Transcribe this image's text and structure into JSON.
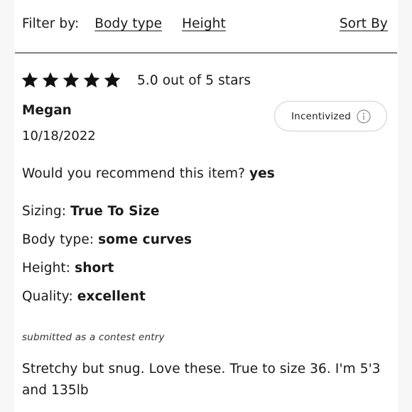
{
  "filter_bar": {
    "label": "Filter by:",
    "body_type_link": "Body type",
    "height_link": "Height",
    "sort_by_link": "Sort By"
  },
  "review": {
    "rating": 5,
    "rating_text": "5.0 out of 5 stars",
    "star_icons": [
      "star-filled",
      "star-filled",
      "star-filled",
      "star-filled",
      "star-filled"
    ],
    "reviewer_name": "Megan",
    "date": "10/18/2022",
    "badge": {
      "label": "Incentivized",
      "icon": "info-circle-icon"
    },
    "recommend_label": "Would you recommend this item?",
    "recommend_value": "yes",
    "sizing_label": "Sizing:",
    "sizing_value": "True To Size",
    "body_type_label": "Body type:",
    "body_type_value": "some curves",
    "height_label": "Height:",
    "height_value": "short",
    "quality_label": "Quality:",
    "quality_value": "excellent",
    "contest_note": "submitted as a contest entry",
    "text": "Stretchy but snug. Love these. True to size 36. I'm 5'3 and 135lb"
  }
}
